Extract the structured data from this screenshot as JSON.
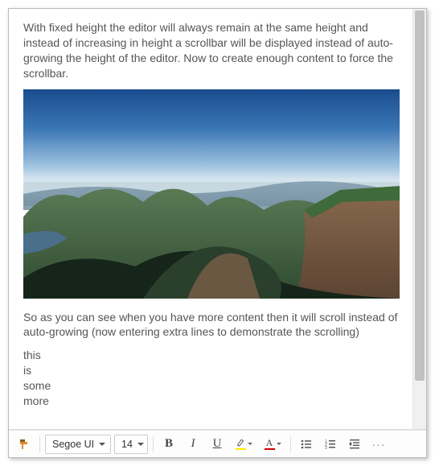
{
  "content": {
    "para1": "With fixed height the editor will always remain at the same height and instead of increasing in height a scrollbar will be displayed instead of auto-growing the height of the editor. Now to create enough content to force the scrollbar.",
    "para2": "So as you can see when you have more content then it will scroll instead of auto-growing (now entering extra lines to demonstrate the scrolling)",
    "lines": [
      "this",
      "is",
      "some",
      "more"
    ],
    "image_alt": "mountain-landscape"
  },
  "toolbar": {
    "font_family": "Segoe UI",
    "font_size": "14",
    "bold": "B",
    "italic": "I",
    "underline": "U",
    "font_color_letter": "A",
    "more": "···"
  }
}
